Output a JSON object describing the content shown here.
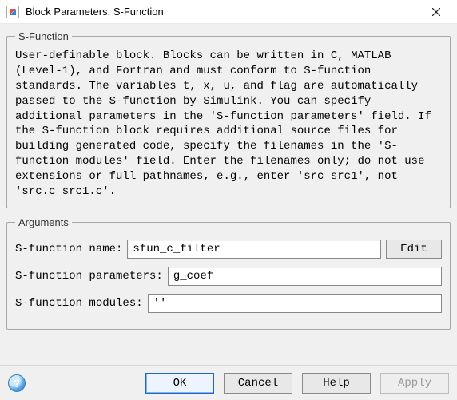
{
  "window": {
    "title": "Block Parameters: S-Function"
  },
  "groups": {
    "sfunction": {
      "legend": "S-Function",
      "description": "User-definable block.  Blocks can be written in C, MATLAB (Level-1), and Fortran and must conform to S-function standards. The variables t, x, u, and flag are automatically passed to the S-function by Simulink.  You can specify additional parameters in the 'S-function parameters' field. If the S-function block requires additional source files for building generated code, specify the filenames in the 'S-function modules' field. Enter the filenames only; do not use extensions or full pathnames, e.g., enter 'src src1', not 'src.c src1.c'."
    },
    "arguments": {
      "legend": "Arguments",
      "name_label": "S-function name:",
      "name_value": "sfun_c_filter",
      "edit_label": "Edit",
      "params_label": "S-function parameters:",
      "params_value": "g_coef",
      "modules_label": "S-function modules:",
      "modules_value": "''"
    }
  },
  "footer": {
    "ok": "OK",
    "cancel": "Cancel",
    "help": "Help",
    "apply": "Apply",
    "help_icon_glyph": "?"
  }
}
